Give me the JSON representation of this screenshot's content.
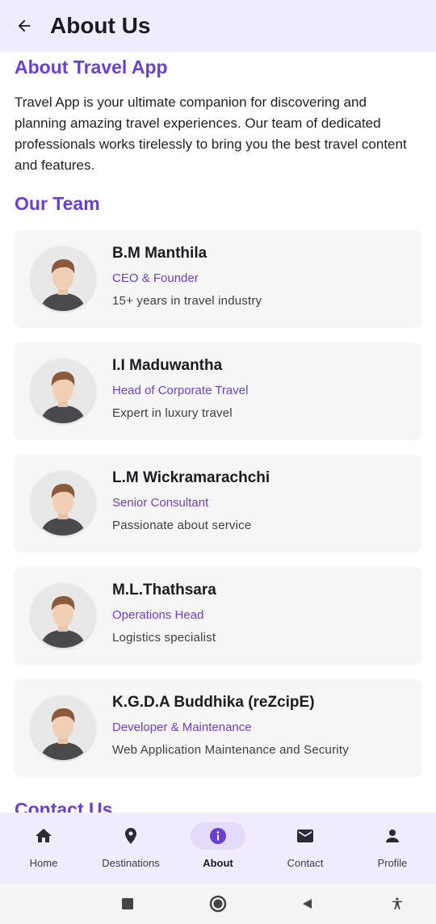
{
  "header": {
    "title": "About Us",
    "back_icon": "arrow-left-icon"
  },
  "about": {
    "heading": "About Travel App",
    "text": "Travel App is your ultimate companion for discovering and planning amazing travel experiences. Our team of dedicated professionals works tirelessly to bring you the best travel content and features."
  },
  "team": {
    "heading": "Our Team",
    "members": [
      {
        "name": "B.M Manthila",
        "role": "CEO & Founder",
        "desc": "15+ years in travel industry"
      },
      {
        "name": "I.I Maduwantha",
        "role": "Head of Corporate Travel",
        "desc": "Expert in luxury travel"
      },
      {
        "name": "L.M Wickramarachchi",
        "role": "Senior Consultant",
        "desc": "Passionate about service"
      },
      {
        "name": "M.L.Thathsara",
        "role": "Operations Head",
        "desc": "Logistics specialist"
      },
      {
        "name": "K.G.D.A Buddhika (reZcipE)",
        "role": "Developer & Maintenance",
        "desc": "Web Application Maintenance and Security"
      }
    ]
  },
  "contact": {
    "heading": "Contact Us"
  },
  "bottom_nav": {
    "items": [
      {
        "label": "Home",
        "icon": "home-icon",
        "active": false
      },
      {
        "label": "Destinations",
        "icon": "location-pin-icon",
        "active": false
      },
      {
        "label": "About",
        "icon": "info-icon",
        "active": true
      },
      {
        "label": "Contact",
        "icon": "mail-icon",
        "active": false
      },
      {
        "label": "Profile",
        "icon": "person-icon",
        "active": false
      }
    ]
  },
  "system_nav": {
    "icons": [
      "recents-icon",
      "home-circle-icon",
      "back-triangle-icon",
      "accessibility-icon"
    ]
  },
  "colors": {
    "accent": "#6a3fd6",
    "bar_background": "#f1ecfd",
    "card_background": "#f6f6f7",
    "active_pill": "#e4dbfa"
  }
}
